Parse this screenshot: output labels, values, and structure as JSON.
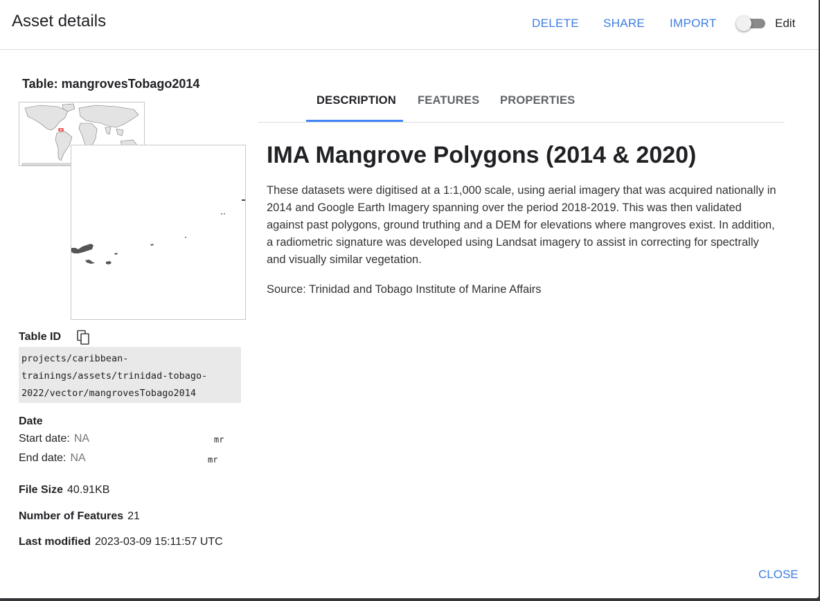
{
  "header": {
    "title": "Asset details",
    "delete_label": "DELETE",
    "share_label": "SHARE",
    "import_label": "IMPORT",
    "edit_label": "Edit",
    "edit_toggle_on": false
  },
  "asset": {
    "table_title": "Table: mangrovesTobago2014",
    "table_id_label": "Table ID",
    "table_id_lines": [
      "projects/caribbean-",
      "trainings/assets/trinidad-tobago-",
      "2022/vector/mangrovesTobago2014"
    ],
    "date_label": "Date",
    "start_date_label": "Start date:",
    "start_date_value": "NA",
    "end_date_label": "End date:",
    "end_date_value": "NA",
    "date_glyph": "mr",
    "file_size_label": "File Size",
    "file_size_value": "40.91KB",
    "features_label": "Number of Features",
    "features_value": "21",
    "modified_label": "Last modified",
    "modified_value": "2023-03-09 15:11:57 UTC"
  },
  "tabs": [
    {
      "label": "DESCRIPTION",
      "active": true
    },
    {
      "label": "FEATURES",
      "active": false
    },
    {
      "label": "PROPERTIES",
      "active": false
    }
  ],
  "description": {
    "title": "IMA Mangrove Polygons (2014 & 2020)",
    "body": "These datasets were digitised at a 1:1,000 scale, using aerial imagery that was acquired nationally in 2014 and Google Earth Imagery spanning over the period 2018-2019. This was then validated against past polygons, ground truthing and a DEM for elevations where mangroves exist. In addition, a radiometric signature was developed using Landsat imagery to assist in correcting for spectrally and visually similar vegetation.",
    "source": "Source: Trinidad and Tobago Institute of Marine Affairs"
  },
  "footer": {
    "close_label": "CLOSE"
  },
  "colors": {
    "accent": "#3d7de0",
    "tab_indicator": "#4285f4",
    "map_highlight": "#e00000"
  },
  "icons": {
    "copy": "copy-icon",
    "toggle": "toggle-switch"
  }
}
